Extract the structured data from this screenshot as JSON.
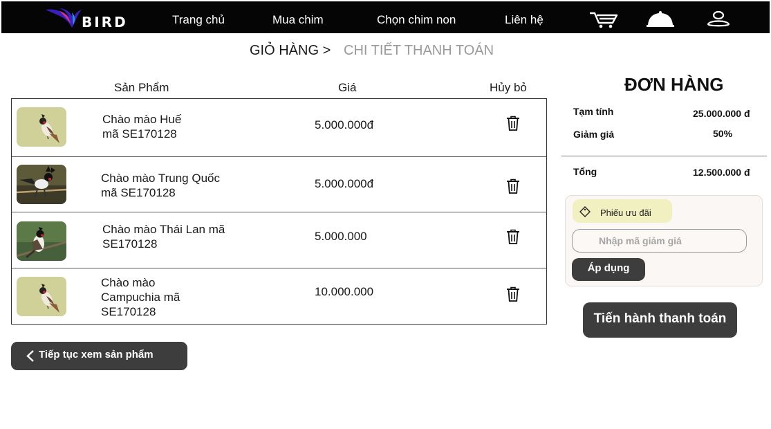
{
  "header": {
    "brand": "BIRD",
    "nav": [
      "Trang chủ",
      "Mua chim",
      "Chọn chim non",
      "Liên hệ"
    ],
    "icons": [
      "cart-icon",
      "bell-icon",
      "user-icon"
    ]
  },
  "breadcrumb": {
    "cart": "GIỎ HÀNG >",
    "checkout": "CHI TIẾT THANH TOÁN"
  },
  "table": {
    "headers": {
      "product": "Sản Phẩm",
      "price": "Giá",
      "cancel": "Hủy bỏ"
    },
    "rows": [
      {
        "name": "Chào mào Huế\nmã SE170128",
        "price": "5.000.000đ"
      },
      {
        "name": "Chào mào Trung Quốc\nmã SE170128",
        "price": "5.000.000đ"
      },
      {
        "name": "Chào mào Thái Lan mã\nSE170128",
        "price": "5.000.000"
      },
      {
        "name": "Chào mào\nCampuchia mã\nSE170128",
        "price": "10.000.000"
      }
    ]
  },
  "continue_label": "Tiếp tục xem sản phẩm",
  "order": {
    "title": "ĐƠN HÀNG",
    "subtotal_label": "Tạm tính",
    "subtotal": "25.000.000 đ",
    "discount_label": "Giảm giá",
    "discount": "50%",
    "total_label": "Tổng",
    "total": "12.500.000 đ",
    "coupon_label": "Phiếu ưu đãi",
    "coupon_placeholder": "Nhập mã giảm giá",
    "apply_label": "Áp dụng",
    "checkout_label": "Tiến hành thanh toán"
  },
  "colors": {
    "topbar": "#050505",
    "button": "#3d3d3d",
    "coupon_tag": "#f0f0c0",
    "muted": "#9a9a9a"
  }
}
